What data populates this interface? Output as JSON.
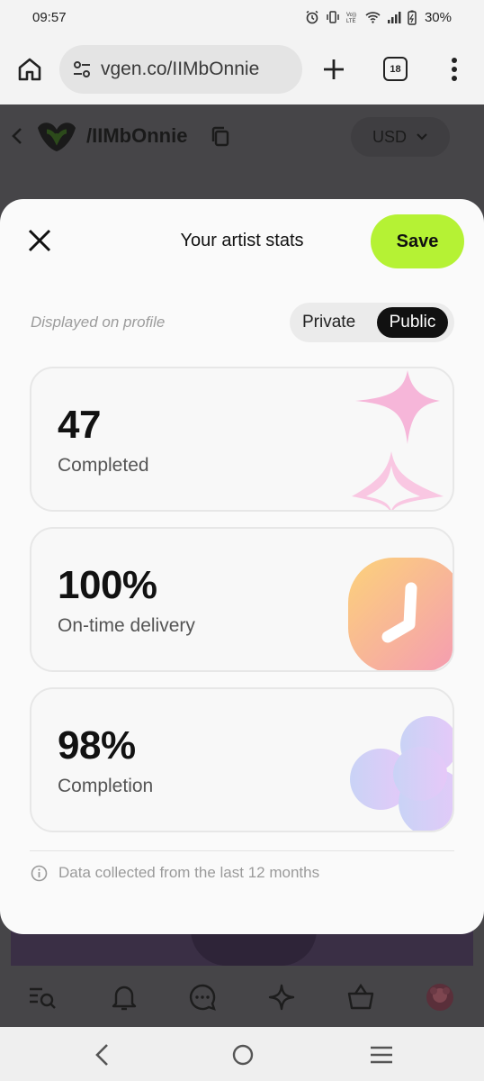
{
  "status_bar": {
    "time": "09:57",
    "battery": "30%"
  },
  "browser": {
    "url": "vgen.co/IIMbOnnie",
    "tab_count": "18"
  },
  "page_header": {
    "handle": "/IIMbOnnie",
    "currency": "USD"
  },
  "modal": {
    "title": "Your artist stats",
    "save_label": "Save",
    "displayed_label": "Displayed on profile",
    "visibility_options": [
      "Private",
      "Public"
    ],
    "selected_visibility": "Public",
    "stats": [
      {
        "value": "47",
        "label": "Completed"
      },
      {
        "value": "100%",
        "label": "On-time delivery"
      },
      {
        "value": "98%",
        "label": "Completion"
      }
    ],
    "info_text": "Data collected from the last 12 months"
  },
  "colors": {
    "save_button": "#b5f234",
    "toggle_selected": "#111111",
    "sparkle_pink": "#f6b6d9",
    "clock_gradient_start": "#fcd27a",
    "clock_gradient_end": "#f49ab4",
    "flower_gradient_start": "#c9d3f6",
    "flower_gradient_end": "#e6c8f8"
  },
  "icons": {
    "home": "home-icon",
    "tune": "tune-icon",
    "new_tab": "plus-icon",
    "menu": "more-vert-icon",
    "back": "chevron-left-icon",
    "copy": "copy-icon",
    "close": "close-icon",
    "info": "info-icon",
    "nav": [
      "search-list-icon",
      "bell-icon",
      "chat-icon",
      "sparkle-icon",
      "basket-icon",
      "avatar"
    ]
  }
}
